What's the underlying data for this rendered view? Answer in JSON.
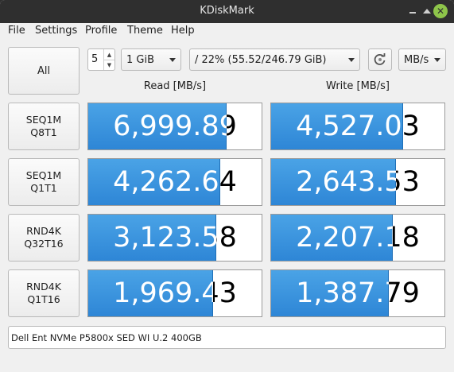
{
  "window": {
    "title": "KDiskMark"
  },
  "menu": [
    "File",
    "Settings",
    "Profile",
    "Theme",
    "Help"
  ],
  "controls": {
    "all_label": "All",
    "runs": "5",
    "size": "1 GiB",
    "target": "/ 22% (55.52/246.79 GiB)",
    "units": "MB/s"
  },
  "columns": {
    "read": "Read [MB/s]",
    "write": "Write [MB/s]"
  },
  "tests": [
    {
      "line1": "SEQ1M",
      "line2": "Q8T1",
      "read": "6,999.89",
      "write": "4,527.03",
      "read_fill": 0.8,
      "write_fill": 0.76
    },
    {
      "line1": "SEQ1M",
      "line2": "Q1T1",
      "read": "4,262.64",
      "write": "2,643.53",
      "read_fill": 0.76,
      "write_fill": 0.72
    },
    {
      "line1": "RND4K",
      "line2": "Q32T16",
      "read": "3,123.58",
      "write": "2,207.18",
      "read_fill": 0.74,
      "write_fill": 0.7
    },
    {
      "line1": "RND4K",
      "line2": "Q1T16",
      "read": "1,969.43",
      "write": "1,387.79",
      "read_fill": 0.72,
      "write_fill": 0.68
    }
  ],
  "comment": "Dell Ent NVMe P5800x SED WI U.2 400GB",
  "colors": {
    "bar": "#3192dc",
    "titlebar": "#2f2f2f",
    "close": "#8ec54a"
  },
  "icons": {
    "refresh": "refresh-icon",
    "close": "close-icon"
  }
}
